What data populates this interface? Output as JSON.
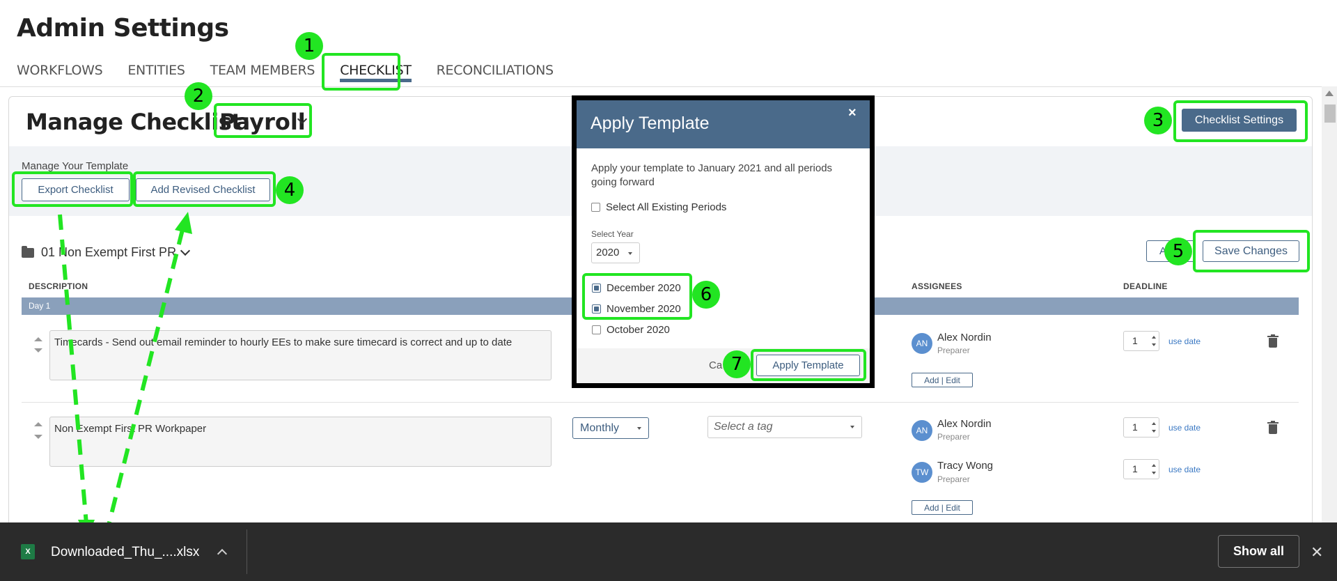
{
  "header": {
    "title": "Admin Settings",
    "tabs": [
      {
        "label": "WORKFLOWS"
      },
      {
        "label": "ENTITIES"
      },
      {
        "label": "TEAM MEMBERS"
      },
      {
        "label": "CHECKLIST"
      },
      {
        "label": "RECONCILIATIONS"
      }
    ],
    "active_tab": "CHECKLIST"
  },
  "manage": {
    "title": "Manage Checklist:",
    "checklist_name": "Payroll",
    "settings_button": "Checklist Settings"
  },
  "template": {
    "label": "Manage Your Template",
    "export_button": "Export Checklist",
    "add_revised_button": "Add Revised Checklist"
  },
  "folder": {
    "name": "01 Non Exempt First PR",
    "add_button_partial": "A",
    "save_button": "Save Changes"
  },
  "columns": {
    "description": "DESCRIPTION",
    "assignees": "ASSIGNEES",
    "deadline": "DEADLINE"
  },
  "day_label": "Day 1",
  "rows": [
    {
      "description": "Timecards - Send out email reminder to hourly EEs to make sure timecard is correct and up to date",
      "assignees": [
        {
          "initials": "AN",
          "name": "Alex Nordin",
          "role": "Preparer",
          "deadline": "1"
        }
      ],
      "add_edit": "Add | Edit"
    },
    {
      "description": "Non Exempt First PR Workpaper",
      "frequency": "Monthly",
      "tag_placeholder": "Select a tag",
      "assignees": [
        {
          "initials": "AN",
          "name": "Alex Nordin",
          "role": "Preparer",
          "deadline": "1"
        },
        {
          "initials": "TW",
          "name": "Tracy Wong",
          "role": "Preparer",
          "deadline": "1"
        }
      ],
      "add_edit": "Add | Edit"
    }
  ],
  "use_date_label": "use date",
  "modal": {
    "title": "Apply Template",
    "close": "×",
    "description": "Apply your template to January 2021 and all periods going forward",
    "select_all": "Select All Existing Periods",
    "year_label": "Select Year",
    "year_value": "2020",
    "periods": [
      {
        "label": "December 2020",
        "checked": true
      },
      {
        "label": "November 2020",
        "checked": true
      },
      {
        "label": "October 2020",
        "checked": false
      }
    ],
    "cancel_partial": "Ca",
    "apply_button": "Apply Template"
  },
  "badges": [
    "1",
    "2",
    "3",
    "4",
    "5",
    "6",
    "7"
  ],
  "download_bar": {
    "icon_text": "X",
    "file_name": "Downloaded_Thu_....xlsx",
    "show_all": "Show all",
    "close": "✕"
  },
  "colors": {
    "accent": "#4a6a8a",
    "highlight": "#22e522",
    "download_bar": "#2b2b2b"
  }
}
